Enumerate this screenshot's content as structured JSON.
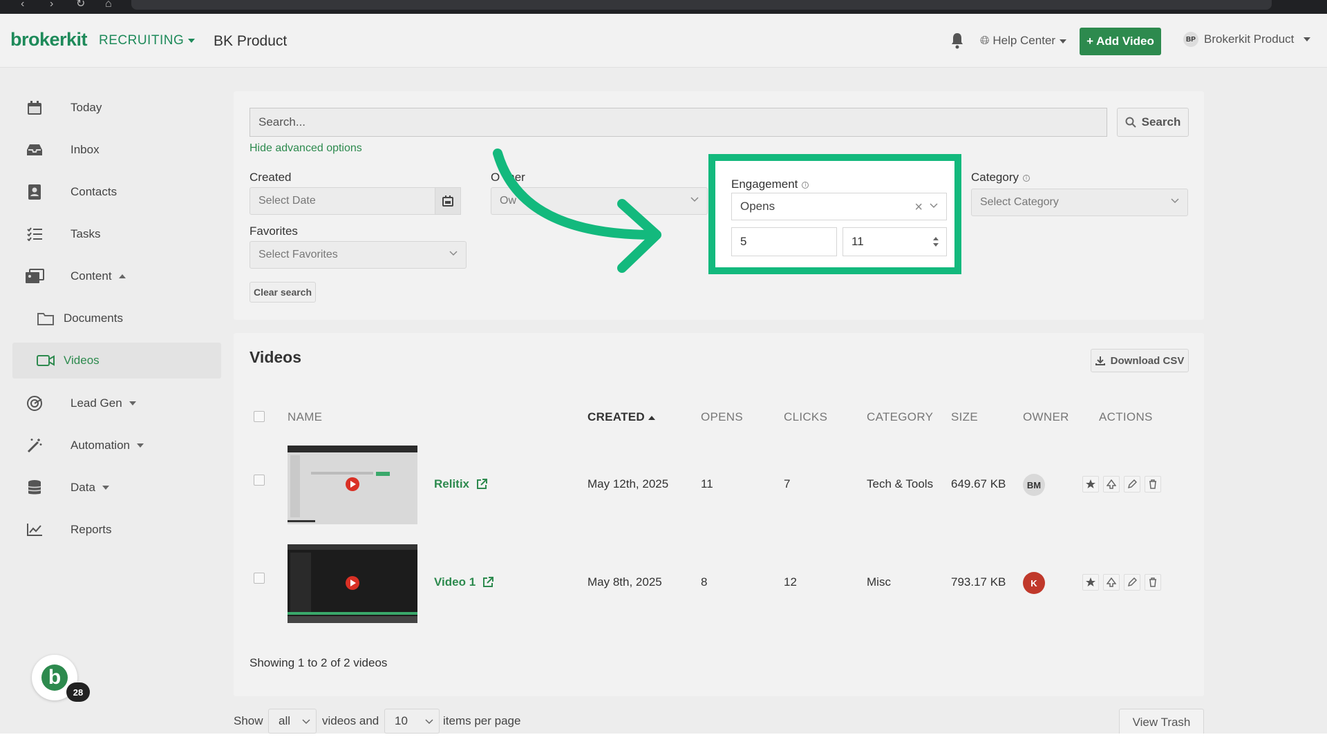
{
  "header": {
    "logo": "brokerkit",
    "module": "RECRUITING",
    "company": "BK Product",
    "help_center": "Help Center",
    "add_video": "+ Add Video",
    "profile_initials": "BP",
    "profile_name": "Brokerkit Product"
  },
  "sidebar": {
    "items": [
      {
        "label": "Today",
        "icon": "calendar-icon"
      },
      {
        "label": "Inbox",
        "icon": "inbox-icon"
      },
      {
        "label": "Contacts",
        "icon": "contacts-icon"
      },
      {
        "label": "Tasks",
        "icon": "tasks-icon"
      },
      {
        "label": "Content",
        "icon": "content-icon"
      },
      {
        "label": "Documents",
        "icon": "folder-icon"
      },
      {
        "label": "Videos",
        "icon": "video-icon"
      },
      {
        "label": "Lead Gen",
        "icon": "lead-gen-icon"
      },
      {
        "label": "Automation",
        "icon": "wand-icon"
      },
      {
        "label": "Data",
        "icon": "database-icon"
      },
      {
        "label": "Reports",
        "icon": "chart-icon"
      }
    ]
  },
  "filters": {
    "search_placeholder": "Search...",
    "search_button": "Search",
    "hide_advanced": "Hide advanced options",
    "created_label": "Created",
    "created_placeholder": "Select Date",
    "owner_label_left": "O",
    "owner_label_right": "ner",
    "owner_placeholder": "Ow",
    "engagement_label": "Engagement",
    "engagement_value": "Opens",
    "engagement_min": "5",
    "engagement_max": "11",
    "category_label": "Category",
    "category_placeholder": "Select Category",
    "favorites_label": "Favorites",
    "favorites_placeholder": "Select Favorites",
    "clear_search": "Clear search"
  },
  "videos": {
    "title": "Videos",
    "download_csv": "Download CSV",
    "columns": {
      "name": "NAME",
      "created": "CREATED",
      "opens": "OPENS",
      "clicks": "CLICKS",
      "category": "CATEGORY",
      "size": "SIZE",
      "owner": "OWNER",
      "actions": "ACTIONS"
    },
    "rows": [
      {
        "name": "Relitix",
        "created": "May 12th, 2025",
        "opens": "11",
        "clicks": "7",
        "category": "Tech & Tools",
        "size": "649.67 KB",
        "owner": "BM",
        "owner_color": "#d9d9d9",
        "owner_text_color": "#333333"
      },
      {
        "name": "Video 1",
        "created": "May 8th, 2025",
        "opens": "8",
        "clicks": "12",
        "category": "Misc",
        "size": "793.17 KB",
        "owner": "K",
        "owner_color": "#c0392b",
        "owner_text_color": "#ffffff"
      }
    ],
    "showing": "Showing 1 to 2 of 2 videos"
  },
  "footer": {
    "show": "Show",
    "show_value": "all",
    "videos_and": "videos and",
    "per_page_value": "10",
    "items_per_page": "items per page",
    "view_trash": "View Trash"
  },
  "chat": {
    "letter": "b",
    "count": "28"
  },
  "colors": {
    "brand_green": "#2d8a4e",
    "highlight_green": "#13b97d"
  }
}
